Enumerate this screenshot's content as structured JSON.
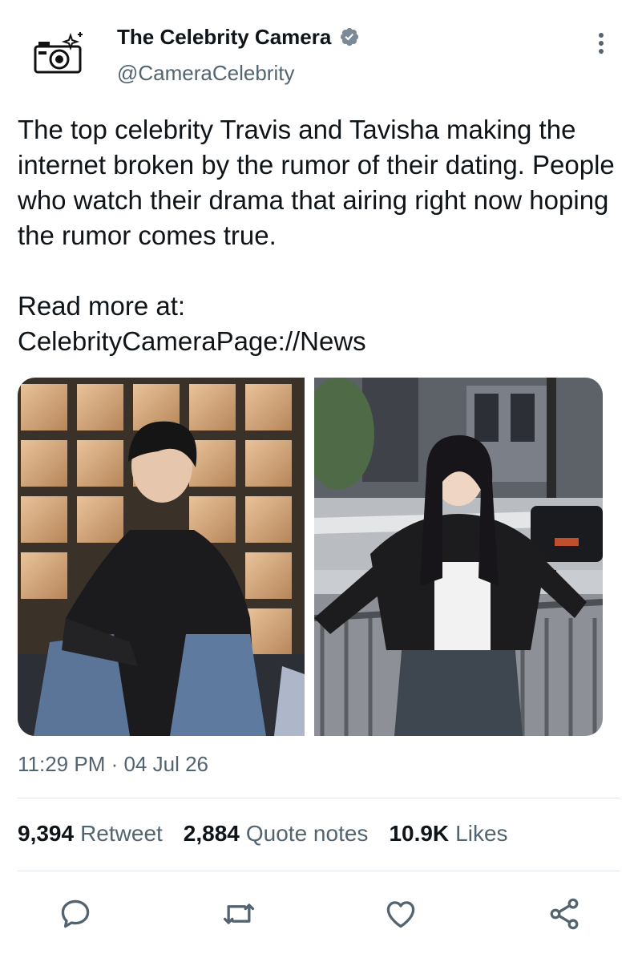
{
  "account": {
    "name": "The Celebrity Camera",
    "handle": "@CameraCelebrity"
  },
  "tweet": {
    "text": "The top celebrity Travis and Tavisha making the internet broken by the rumor of their dating. People who watch their drama that airing right now hoping the rumor comes true.\n\nRead more at:\nCelebrityCameraPage://News"
  },
  "timestamp": {
    "time": "11:29 PM",
    "separator": " · ",
    "date": "04 Jul 26"
  },
  "stats": {
    "retweets_count": "9,394",
    "retweets_label": "Retweet",
    "quotes_count": "2,884",
    "quotes_label": "Quote notes",
    "likes_count": "10.9K",
    "likes_label": "Likes"
  },
  "colors": {
    "text_primary": "#0f1419",
    "text_secondary": "#536471",
    "verified_blue": "#1d9bf0",
    "divider": "#e1e6ea"
  },
  "icons": {
    "avatar": "camera-logo-icon",
    "verified": "verified-badge-icon",
    "more": "more-vertical-icon",
    "reply": "reply-icon",
    "retweet": "retweet-icon",
    "like": "heart-icon",
    "share": "share-icon"
  }
}
